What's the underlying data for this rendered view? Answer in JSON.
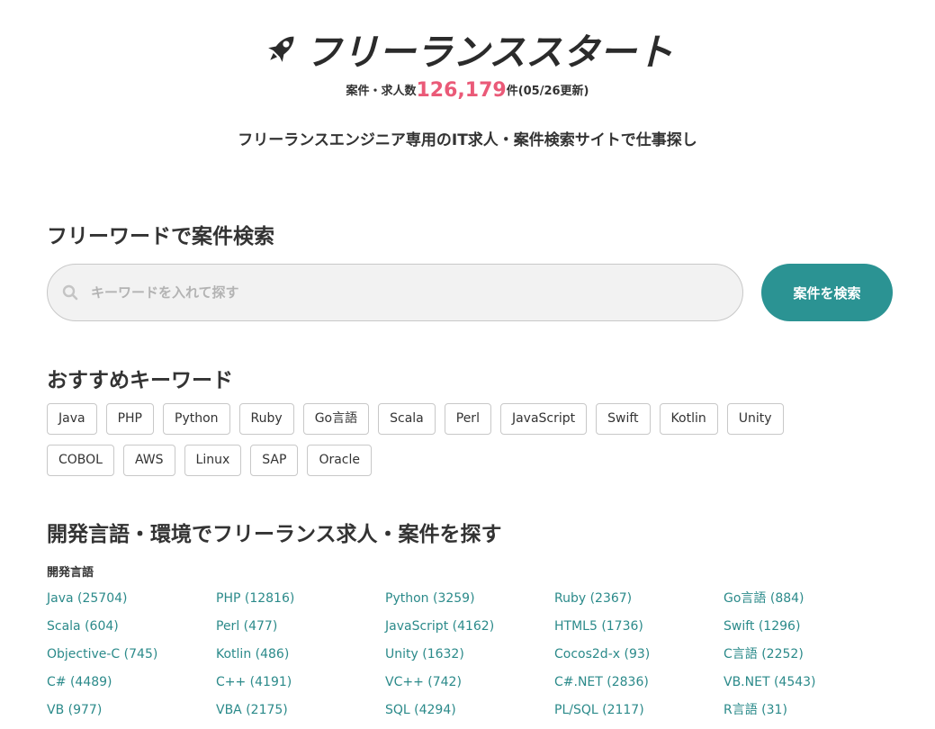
{
  "header": {
    "logo_text": "フリーランススタート",
    "stats_prefix": "案件・求人数",
    "stats_count": "126,179",
    "stats_suffix": "件(05/26更新)",
    "tagline": "フリーランスエンジニア専用のIT求人・案件検索サイトで仕事探し"
  },
  "colors": {
    "accent": "#2b9393",
    "count": "#ea5a78",
    "link": "#2b8a8a"
  },
  "search": {
    "title": "フリーワードで案件検索",
    "placeholder": "キーワードを入れて探す",
    "value": "",
    "button_label": "案件を検索",
    "icon": "search-icon"
  },
  "keywords": {
    "title": "おすすめキーワード",
    "items": [
      "Java",
      "PHP",
      "Python",
      "Ruby",
      "Go言語",
      "Scala",
      "Perl",
      "JavaScript",
      "Swift",
      "Kotlin",
      "Unity",
      "COBOL",
      "AWS",
      "Linux",
      "SAP",
      "Oracle"
    ]
  },
  "languages": {
    "title": "開発言語・環境でフリーランス求人・案件を探す",
    "subtitle": "開発言語",
    "items": [
      "Java (25704)",
      "PHP (12816)",
      "Python (3259)",
      "Ruby (2367)",
      "Go言語 (884)",
      "Scala (604)",
      "Perl (477)",
      "JavaScript (4162)",
      "HTML5 (1736)",
      "Swift (1296)",
      "Objective-C (745)",
      "Kotlin (486)",
      "Unity (1632)",
      "Cocos2d-x (93)",
      "C言語 (2252)",
      "C# (4489)",
      "C++ (4191)",
      "VC++ (742)",
      "C#.NET (2836)",
      "VB.NET (4543)",
      "VB (977)",
      "VBA (2175)",
      "SQL (4294)",
      "PL/SQL (2117)",
      "R言語 (31)"
    ]
  }
}
